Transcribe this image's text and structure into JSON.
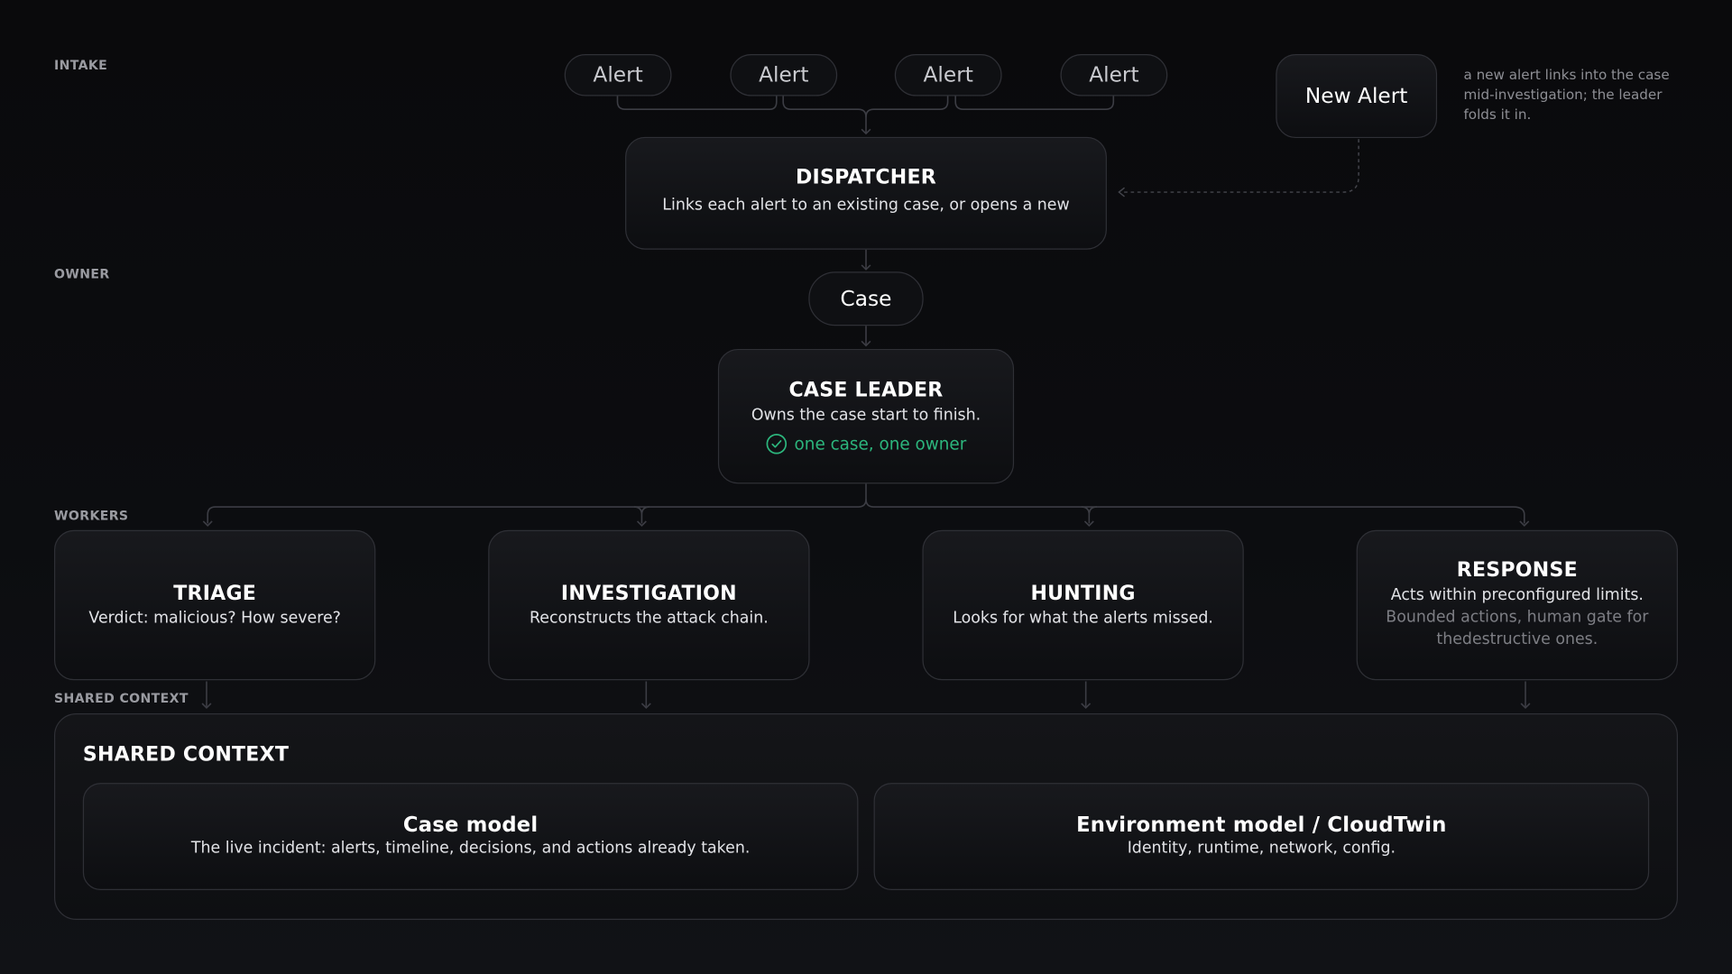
{
  "sections": {
    "intake": "INTAKE",
    "owner": "OWNER",
    "workers": "WORKERS",
    "shared_context": "SHARED CONTEXT"
  },
  "alerts": [
    "Alert",
    "Alert",
    "Alert",
    "Alert"
  ],
  "new_alert": {
    "label": "New Alert",
    "note": "a new alert links into the case mid-investigation; the leader folds it in."
  },
  "dispatcher": {
    "title": "DISPATCHER",
    "desc": "Links each alert to an existing case, or opens a new"
  },
  "case_pill": "Case",
  "case_leader": {
    "title": "CASE LEADER",
    "desc": "Owns the case start to finish.",
    "badge": "one case, one owner",
    "badge_color": "#2cb67d"
  },
  "workers": {
    "triage": {
      "title": "TRIAGE",
      "desc": "Verdict: malicious? How severe?"
    },
    "investigation": {
      "title": "INVESTIGATION",
      "desc": "Reconstructs the attack chain."
    },
    "hunting": {
      "title": "HUNTING",
      "desc": "Looks for what the alerts missed."
    },
    "response": {
      "title": "RESPONSE",
      "desc": "Acts within preconfigured limits.",
      "note": "Bounded actions, human gate for thedestructive ones."
    }
  },
  "shared_context": {
    "title": "SHARED CONTEXT",
    "case_model": {
      "title": "Case model",
      "desc": "The live incident: alerts, timeline, decisions, and actions already taken."
    },
    "environment_model": {
      "title": "Environment model / CloudTwin",
      "desc": "Identity, runtime, network, config."
    }
  },
  "colors": {
    "background": "#0b0b0d",
    "border": "#2f3036",
    "connector": "#3c3d44",
    "accent_green": "#2cb67d"
  }
}
